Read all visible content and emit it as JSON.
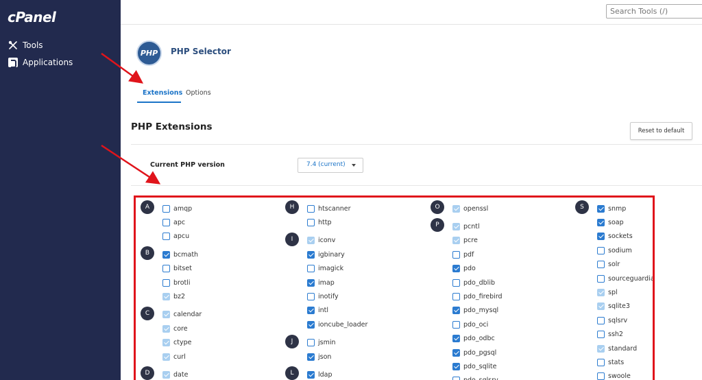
{
  "sidebar": {
    "logo": "cPanel",
    "items": [
      {
        "label": "Tools",
        "icon": "tools-icon"
      },
      {
        "label": "Applications",
        "icon": "applications-icon"
      }
    ]
  },
  "topbar": {
    "search_placeholder": "Search Tools (/)"
  },
  "header": {
    "logo_text": "PHP",
    "title": "PHP Selector"
  },
  "tabs": [
    {
      "label": "Extensions",
      "active": true
    },
    {
      "label": "Options",
      "active": false
    }
  ],
  "section": {
    "title": "PHP Extensions",
    "reset_label": "Reset to default",
    "version_label": "Current PHP version",
    "version_value": "7.4 (current)"
  },
  "colors": {
    "sidebar": "#222a4e",
    "accent": "#1a73c7",
    "highlight": "#e0141b"
  },
  "columns": [
    {
      "groups": [
        {
          "letter": "A",
          "items": [
            {
              "name": "amqp",
              "state": "off"
            },
            {
              "name": "apc",
              "state": "off"
            },
            {
              "name": "apcu",
              "state": "off"
            }
          ]
        },
        {
          "letter": "B",
          "items": [
            {
              "name": "bcmath",
              "state": "on"
            },
            {
              "name": "bitset",
              "state": "off"
            },
            {
              "name": "brotli",
              "state": "off"
            },
            {
              "name": "bz2",
              "state": "dim"
            }
          ]
        },
        {
          "letter": "C",
          "items": [
            {
              "name": "calendar",
              "state": "dim"
            },
            {
              "name": "core",
              "state": "dim"
            },
            {
              "name": "ctype",
              "state": "dim"
            },
            {
              "name": "curl",
              "state": "dim"
            }
          ]
        },
        {
          "letter": "D",
          "items": [
            {
              "name": "date",
              "state": "dim"
            }
          ]
        }
      ]
    },
    {
      "groups": [
        {
          "letter": "H",
          "items": [
            {
              "name": "htscanner",
              "state": "off"
            },
            {
              "name": "http",
              "state": "off"
            }
          ]
        },
        {
          "letter": "I",
          "items": [
            {
              "name": "iconv",
              "state": "dim"
            },
            {
              "name": "igbinary",
              "state": "on"
            },
            {
              "name": "imagick",
              "state": "off"
            },
            {
              "name": "imap",
              "state": "on"
            },
            {
              "name": "inotify",
              "state": "off"
            },
            {
              "name": "intl",
              "state": "on"
            },
            {
              "name": "ioncube_loader",
              "state": "on"
            }
          ]
        },
        {
          "letter": "J",
          "items": [
            {
              "name": "jsmin",
              "state": "off"
            },
            {
              "name": "json",
              "state": "on"
            }
          ]
        },
        {
          "letter": "L",
          "items": [
            {
              "name": "ldap",
              "state": "on"
            }
          ]
        }
      ]
    },
    {
      "groups": [
        {
          "letter": "O",
          "items": [
            {
              "name": "openssl",
              "state": "dim"
            }
          ]
        },
        {
          "letter": "P",
          "items": [
            {
              "name": "pcntl",
              "state": "dim"
            },
            {
              "name": "pcre",
              "state": "dim"
            },
            {
              "name": "pdf",
              "state": "off"
            },
            {
              "name": "pdo",
              "state": "on"
            },
            {
              "name": "pdo_dblib",
              "state": "off"
            },
            {
              "name": "pdo_firebird",
              "state": "off"
            },
            {
              "name": "pdo_mysql",
              "state": "on"
            },
            {
              "name": "pdo_oci",
              "state": "off"
            },
            {
              "name": "pdo_odbc",
              "state": "on"
            },
            {
              "name": "pdo_pgsql",
              "state": "on"
            },
            {
              "name": "pdo_sqlite",
              "state": "on"
            },
            {
              "name": "pdo_sqlsrv",
              "state": "off"
            }
          ]
        }
      ]
    },
    {
      "groups": [
        {
          "letter": "S",
          "items": [
            {
              "name": "snmp",
              "state": "on"
            },
            {
              "name": "soap",
              "state": "on"
            },
            {
              "name": "sockets",
              "state": "on"
            },
            {
              "name": "sodium",
              "state": "off"
            },
            {
              "name": "solr",
              "state": "off"
            },
            {
              "name": "sourceguardian",
              "state": "off"
            },
            {
              "name": "spl",
              "state": "dim"
            },
            {
              "name": "sqlite3",
              "state": "dim"
            },
            {
              "name": "sqlsrv",
              "state": "off"
            },
            {
              "name": "ssh2",
              "state": "off"
            },
            {
              "name": "standard",
              "state": "dim"
            },
            {
              "name": "stats",
              "state": "off"
            },
            {
              "name": "swoole",
              "state": "off"
            }
          ]
        }
      ]
    }
  ]
}
